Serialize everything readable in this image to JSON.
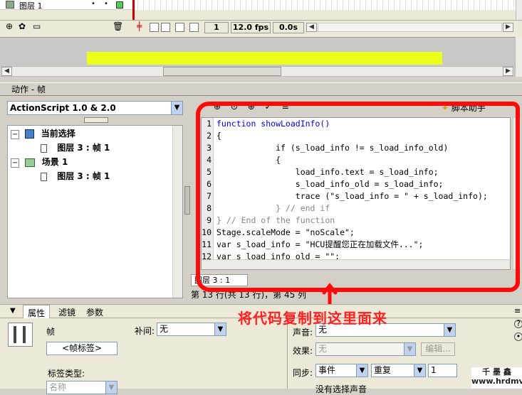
{
  "timeline": {
    "layer_name": "图层 1",
    "frame_number": "1",
    "fps": "12.0 fps",
    "time": "0.0s"
  },
  "panel": {
    "title": "动作 - 帧"
  },
  "script_version": "ActionScript 1.0 & 2.0",
  "script_assist": "脚本助手",
  "tree": {
    "items": [
      {
        "label": "当前选择"
      },
      {
        "label": "图层 3 : 帧 1"
      },
      {
        "label": "场景 1"
      },
      {
        "label": "图层 3 : 帧 1"
      }
    ]
  },
  "code": {
    "line_numbers": [
      "1",
      "2",
      "3",
      "4",
      "5",
      "6",
      "7",
      "8",
      "9",
      "10",
      "11",
      "12"
    ],
    "lines": [
      "function showLoadInfo()",
      "{",
      "            if (s_load_info != s_load_info_old)",
      "            {",
      "                load_info.text = s_load_info;",
      "                s_load_info_old = s_load_info;",
      "                trace (\"s_load_info = \" + s_load_info);",
      "            } // end if",
      "} // End of the function",
      "Stage.scaleMode = \"noScale\";",
      "var s_load_info = \"HCU提醒您正在加载文件...\";",
      "var s_load_info_old = \"\";"
    ]
  },
  "layer_tab": "图层 3 : 1",
  "status": "第 13 行(共 13 行)，第 45 列",
  "props_tabs": [
    "属性",
    "滤镜",
    "参数"
  ],
  "props": {
    "frame_label": "帧",
    "frame_tag_placeholder": "<帧标签>",
    "label_type": "标签类型:",
    "label_type_value": "名称",
    "tween_label": "补间:",
    "tween_value": "无",
    "sound_label": "声音:",
    "sound_value": "无",
    "effect_label": "效果:",
    "effect_value": "无",
    "edit_button": "编辑...",
    "sync_label": "同步:",
    "sync_value": "事件",
    "repeat_value": "重复",
    "repeat_count": "1",
    "no_sound": "没有选择声音"
  },
  "annotation": "将代码复制到这里面来",
  "watermark": "千 墨 鑫 www.hrdmv.com",
  "colors": {
    "annotation": "#ff0a0a",
    "stage_bar": "#eaff1a"
  }
}
